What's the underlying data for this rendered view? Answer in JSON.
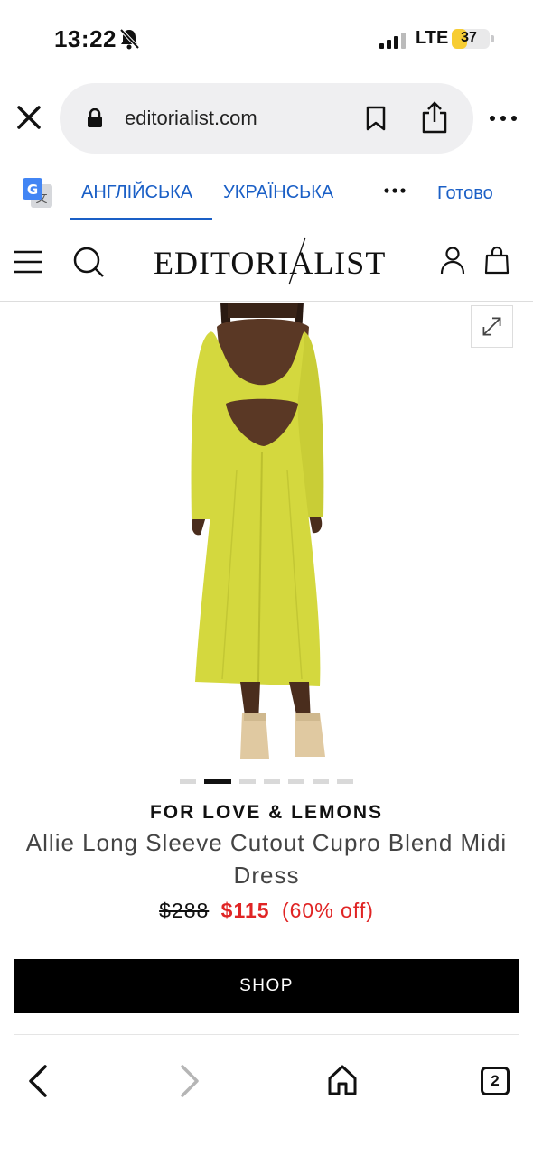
{
  "status_bar": {
    "time": "13:22",
    "network": "LTE",
    "battery": "37",
    "battery_level": 0.37
  },
  "browser": {
    "url": "editorialist.com",
    "icons": [
      "close-icon",
      "lock-icon",
      "bookmark-icon",
      "share-icon",
      "more-icon"
    ]
  },
  "translate_bar": {
    "source_language": "АНГЛІЙСЬКА",
    "target_language": "УКРАЇНСЬКА",
    "done_label": "Готово"
  },
  "site_header": {
    "logo_text": "EDITORIALIST",
    "icons": [
      "menu-icon",
      "search-icon",
      "user-icon",
      "bag-icon"
    ]
  },
  "product": {
    "carousel_count": 7,
    "carousel_active_index": 1,
    "brand": "FOR LOVE & LEMONS",
    "title": "Allie Long Sleeve Cutout Cupro Blend Midi Dress",
    "original_price": "$288",
    "sale_price": "$115",
    "discount": "(60% off)",
    "shop_label": "SHOP",
    "dress_color": "#d4d83e"
  },
  "bottom_nav": {
    "tabs_count": "2"
  }
}
